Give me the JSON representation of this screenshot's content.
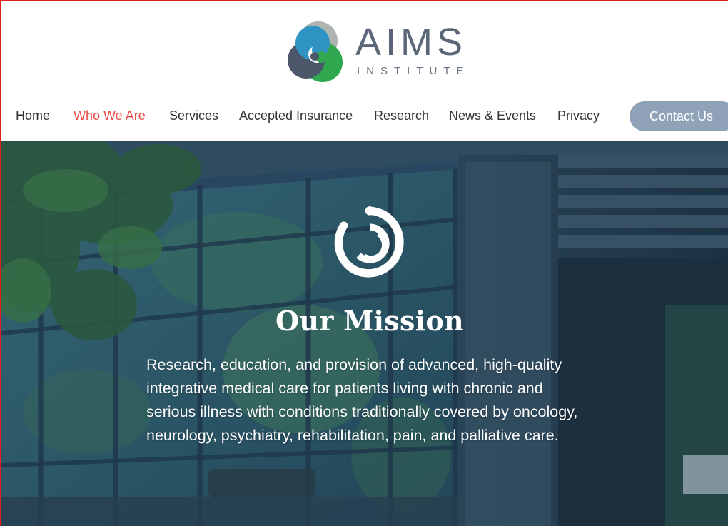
{
  "brand": {
    "name": "AIMS",
    "subtitle": "INSTITUTE",
    "colors": {
      "teal": "#2f93c4",
      "green": "#2fa84f",
      "gray": "#aeb5b1",
      "slate": "#4c586a"
    }
  },
  "nav": {
    "items": [
      {
        "label": "Home",
        "active": false
      },
      {
        "label": "Who We Are",
        "active": true
      },
      {
        "label": "Services",
        "active": false
      },
      {
        "label": "Accepted Insurance",
        "active": false
      },
      {
        "label": "Research",
        "active": false
      },
      {
        "label": "News & Events",
        "active": false
      },
      {
        "label": "Privacy",
        "active": false
      }
    ],
    "contact_label": "Contact Us",
    "active_color": "#e84b43",
    "contact_bg": "#8fa2b8"
  },
  "hero": {
    "icon": "aims-swirl-icon",
    "title": "Our Mission",
    "text": "Research, education, and provision of advanced, high-quality integrative medical care for patients living with chronic and serious illness with conditions traditionally covered by oncology, neurology, psychiatry, rehabilitation, pain, and palliative care.",
    "overlay_color": "#1e3b53"
  }
}
